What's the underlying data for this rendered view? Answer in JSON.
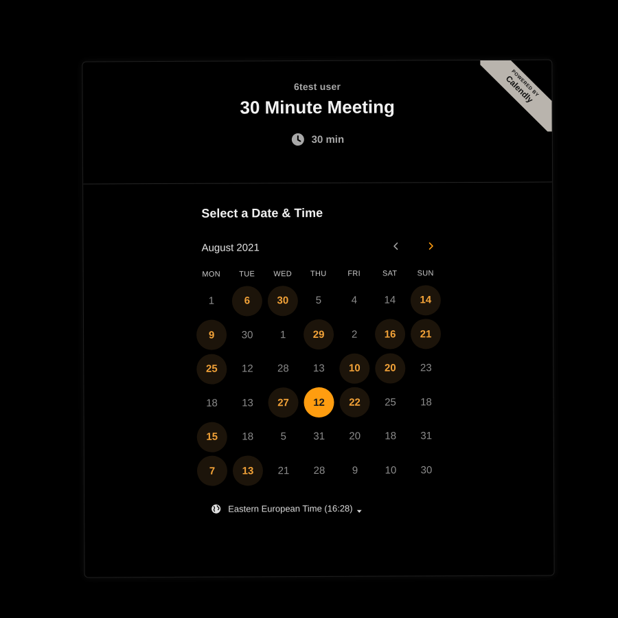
{
  "header": {
    "user_name": "6test user",
    "event_title": "30 Minute Meeting",
    "duration": "30 min",
    "duration_icon": "clock-icon"
  },
  "ribbon": {
    "small_text": "POWERED BY",
    "brand": "Calendly",
    "color": "#b9b4ad"
  },
  "calendar": {
    "section_title": "Select a Date & Time",
    "month": "August 2021",
    "prev_icon": "chevron-left-icon",
    "next_icon": "chevron-right-icon",
    "weekdays": [
      "MON",
      "TUE",
      "WED",
      "THU",
      "FRI",
      "SAT",
      "SUN"
    ],
    "weeks": [
      [
        {
          "label": "1",
          "state": "disabled"
        },
        {
          "label": "6",
          "state": "available"
        },
        {
          "label": "30",
          "state": "available"
        },
        {
          "label": "5",
          "state": "disabled"
        },
        {
          "label": "4",
          "state": "disabled"
        },
        {
          "label": "14",
          "state": "disabled"
        },
        {
          "label": "14",
          "state": "available"
        }
      ],
      [
        {
          "label": "9",
          "state": "available"
        },
        {
          "label": "30",
          "state": "disabled"
        },
        {
          "label": "1",
          "state": "disabled"
        },
        {
          "label": "29",
          "state": "available"
        },
        {
          "label": "2",
          "state": "disabled"
        },
        {
          "label": "16",
          "state": "available"
        },
        {
          "label": "21",
          "state": "available"
        }
      ],
      [
        {
          "label": "25",
          "state": "available"
        },
        {
          "label": "12",
          "state": "disabled"
        },
        {
          "label": "28",
          "state": "disabled"
        },
        {
          "label": "13",
          "state": "disabled"
        },
        {
          "label": "10",
          "state": "available"
        },
        {
          "label": "20",
          "state": "available"
        },
        {
          "label": "23",
          "state": "disabled"
        }
      ],
      [
        {
          "label": "18",
          "state": "disabled"
        },
        {
          "label": "13",
          "state": "disabled"
        },
        {
          "label": "27",
          "state": "available"
        },
        {
          "label": "12",
          "state": "selected"
        },
        {
          "label": "22",
          "state": "available"
        },
        {
          "label": "25",
          "state": "disabled"
        },
        {
          "label": "18",
          "state": "disabled"
        }
      ],
      [
        {
          "label": "15",
          "state": "available"
        },
        {
          "label": "18",
          "state": "disabled"
        },
        {
          "label": "5",
          "state": "disabled"
        },
        {
          "label": "31",
          "state": "disabled"
        },
        {
          "label": "20",
          "state": "disabled"
        },
        {
          "label": "18",
          "state": "disabled"
        },
        {
          "label": "31",
          "state": "disabled"
        }
      ],
      [
        {
          "label": "7",
          "state": "available"
        },
        {
          "label": "13",
          "state": "available"
        },
        {
          "label": "21",
          "state": "disabled"
        },
        {
          "label": "28",
          "state": "disabled"
        },
        {
          "label": "9",
          "state": "disabled"
        },
        {
          "label": "10",
          "state": "disabled"
        },
        {
          "label": "30",
          "state": "disabled"
        }
      ]
    ],
    "colors": {
      "accent": "#ff9d10",
      "available_text": "#f2a238",
      "available_bg": "#1c140a",
      "disabled_text": "#8b8b8b"
    }
  },
  "timezone": {
    "label": "Eastern European Time (16:28)",
    "icon": "globe-icon",
    "caret_icon": "caret-down-icon"
  }
}
